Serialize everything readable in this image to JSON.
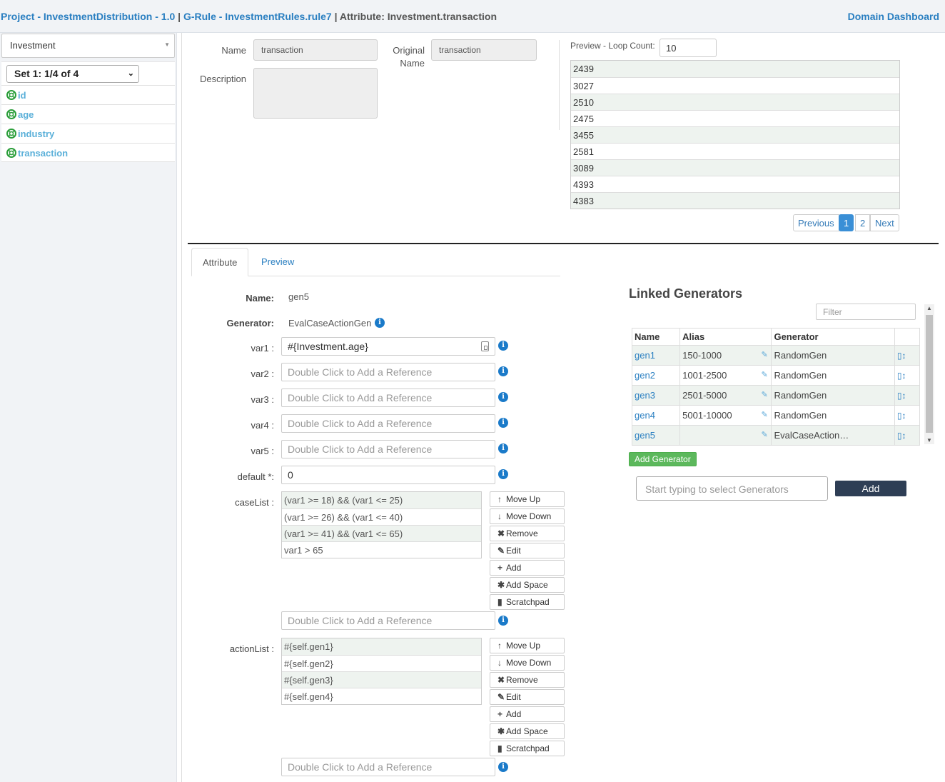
{
  "header": {
    "project_link": "Project - InvestmentDistribution - 1.0",
    "sep1": " | ",
    "rule_link": "G-Rule - InvestmentRules.rule7",
    "attribute_text": " | Attribute: Investment.transaction",
    "dashboard_link": "Domain Dashboard"
  },
  "sidebar": {
    "entity_select": "Investment",
    "set_select": "Set 1: 1/4 of 4",
    "attributes": [
      "id",
      "age",
      "industry",
      "transaction"
    ]
  },
  "details": {
    "name_label": "Name",
    "name_value": "transaction",
    "original_label_1": "Original",
    "original_label_2": "Name",
    "original_value": "transaction",
    "description_label": "Description"
  },
  "preview": {
    "loop_label": "Preview - Loop Count:",
    "loop_count": "10",
    "values": [
      "2439",
      "3027",
      "2510",
      "2475",
      "3455",
      "2581",
      "3089",
      "4393",
      "4383"
    ],
    "pager": {
      "previous": "Previous",
      "page1": "1",
      "page2": "2",
      "next": "Next"
    }
  },
  "tabs": {
    "attribute": "Attribute",
    "preview": "Preview"
  },
  "form": {
    "name_label": "Name:",
    "name_value": "gen5",
    "generator_label": "Generator:",
    "generator_value": "EvalCaseActionGen",
    "var1_label": "var1 :",
    "var1_value": "#{Investment.age}",
    "var2_label": "var2 :",
    "var3_label": "var3 :",
    "var4_label": "var4 :",
    "var5_label": "var5 :",
    "ref_placeholder": "Double Click to Add a Reference",
    "default_label": "default *:",
    "default_value": "0",
    "caselist_label": "caseList :",
    "caselist": [
      "(var1 >= 18) && (var1 <= 25)",
      "(var1 >= 26) && (var1 <= 40)",
      "(var1 >= 41) && (var1 <= 65)",
      "var1 > 65"
    ],
    "actionlist_label": "actionList :",
    "actionlist": [
      "#{self.gen1}",
      "#{self.gen2}",
      "#{self.gen3}",
      "#{self.gen4}"
    ],
    "buttons": {
      "move_up": "Move Up",
      "move_down": "Move Down",
      "remove": "Remove",
      "edit": "Edit",
      "add": "Add",
      "add_space": "Add Space",
      "scratchpad": "Scratchpad"
    }
  },
  "linked": {
    "title": "Linked Generators",
    "filter_placeholder": "Filter",
    "columns": {
      "name": "Name",
      "alias": "Alias",
      "generator": "Generator"
    },
    "rows": [
      {
        "name": "gen1",
        "alias": "150-1000",
        "generator": "RandomGen"
      },
      {
        "name": "gen2",
        "alias": "1001-2500",
        "generator": "RandomGen"
      },
      {
        "name": "gen3",
        "alias": "2501-5000",
        "generator": "RandomGen"
      },
      {
        "name": "gen4",
        "alias": "5001-10000",
        "generator": "RandomGen"
      },
      {
        "name": "gen5",
        "alias": "",
        "generator": "EvalCaseAction…"
      }
    ],
    "add_generator": "Add Generator",
    "search_placeholder": "Start typing to select Generators",
    "add_button": "Add"
  }
}
